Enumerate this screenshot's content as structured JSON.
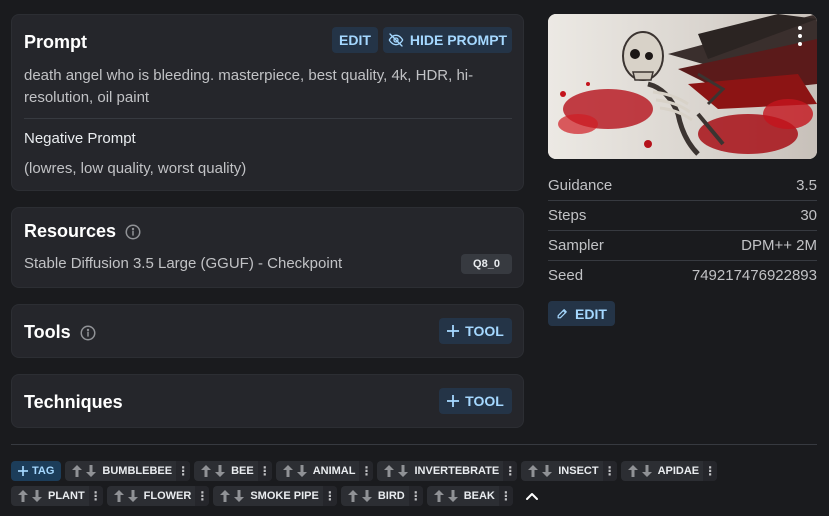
{
  "prompt_card": {
    "title": "Prompt",
    "edit_label": "EDIT",
    "hide_label": "HIDE PROMPT",
    "prompt_text": "death angel who is bleeding. masterpiece, best quality, 4k, HDR, hi-resolution, oil paint",
    "negative_title": "Negative Prompt",
    "negative_text": "(lowres, low quality, worst quality)"
  },
  "resources_card": {
    "title": "Resources",
    "resource_name": "Stable Diffusion 3.5 Large (GGUF) - Checkpoint",
    "resource_badge": "Q8_0"
  },
  "tools_card": {
    "title": "Tools",
    "add_label": "TOOL"
  },
  "techniques_card": {
    "title": "Techniques",
    "add_label": "TOOL"
  },
  "meta": {
    "guidance_label": "Guidance",
    "guidance_value": "3.5",
    "steps_label": "Steps",
    "steps_value": "30",
    "sampler_label": "Sampler",
    "sampler_value": "DPM++ 2M",
    "seed_label": "Seed",
    "seed_value": "749217476922893",
    "edit_label": "EDIT"
  },
  "tags": {
    "add_label": "TAG",
    "row1": [
      "BUMBLEBEE",
      "BEE",
      "ANIMAL",
      "INVERTEBRATE",
      "INSECT",
      "APIDAE"
    ],
    "row2": [
      "PLANT",
      "FLOWER",
      "SMOKE PIPE",
      "BIRD",
      "BEAK"
    ]
  },
  "colors": {
    "background": "#1a1b1e",
    "card": "#25262b",
    "accent_text": "#a5d8ff",
    "accent_bg": "#243447"
  }
}
